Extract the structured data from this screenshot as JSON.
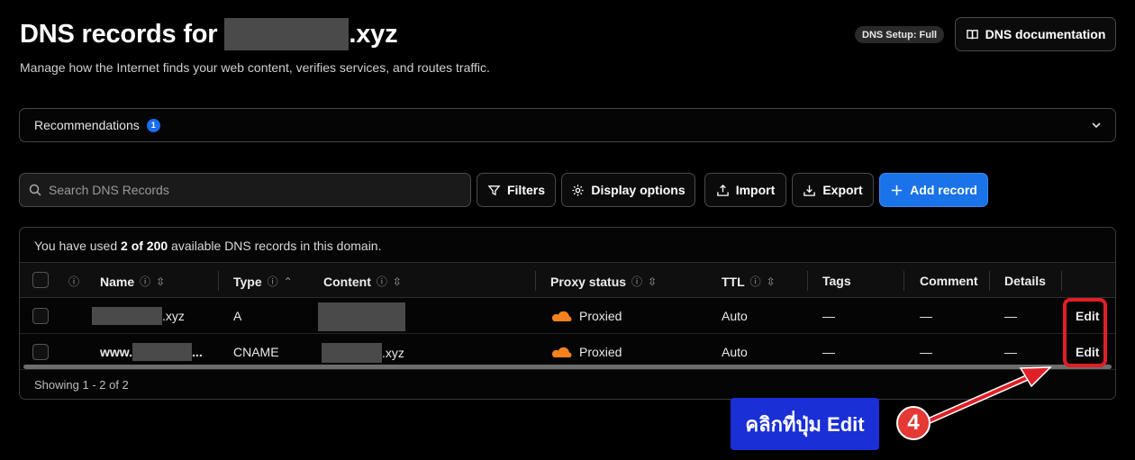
{
  "header": {
    "title_prefix": "DNS records for",
    "title_suffix": ".xyz",
    "subtitle": "Manage how the Internet finds your web content, verifies services, and routes traffic.",
    "setup_badge": "DNS Setup: Full",
    "docs_button": "DNS documentation"
  },
  "recommendations": {
    "label": "Recommendations",
    "count": "1"
  },
  "toolbar": {
    "search_placeholder": "Search DNS Records",
    "filters": "Filters",
    "display_options": "Display options",
    "import": "Import",
    "export": "Export",
    "add_record": "Add record"
  },
  "usage": {
    "prefix": "You have used",
    "count": "2 of 200",
    "suffix": "available DNS records in this domain."
  },
  "table": {
    "columns": [
      "Name",
      "Type",
      "Content",
      "Proxy status",
      "TTL",
      "Tags",
      "Comment",
      "Details"
    ],
    "rows": [
      {
        "name_suffix": ".xyz",
        "type": "A",
        "content_suffix": "",
        "proxy": "Proxied",
        "ttl": "Auto",
        "tags": "—",
        "comment": "—",
        "details": "—",
        "action": "Edit"
      },
      {
        "name_prefix": "www.",
        "name_suffix": "...",
        "type": "CNAME",
        "content_suffix": ".xyz",
        "proxy": "Proxied",
        "ttl": "Auto",
        "tags": "—",
        "comment": "—",
        "details": "—",
        "action": "Edit"
      }
    ],
    "showing": "Showing 1 - 2 of 2"
  },
  "annotation": {
    "callout": "คลิกที่ปุ่ม Edit",
    "step": "4"
  },
  "colors": {
    "accent": "#1a73e8",
    "proxy_cloud": "#f6821f",
    "highlight": "#e01f26",
    "callout_bg": "#1a2fd6"
  }
}
